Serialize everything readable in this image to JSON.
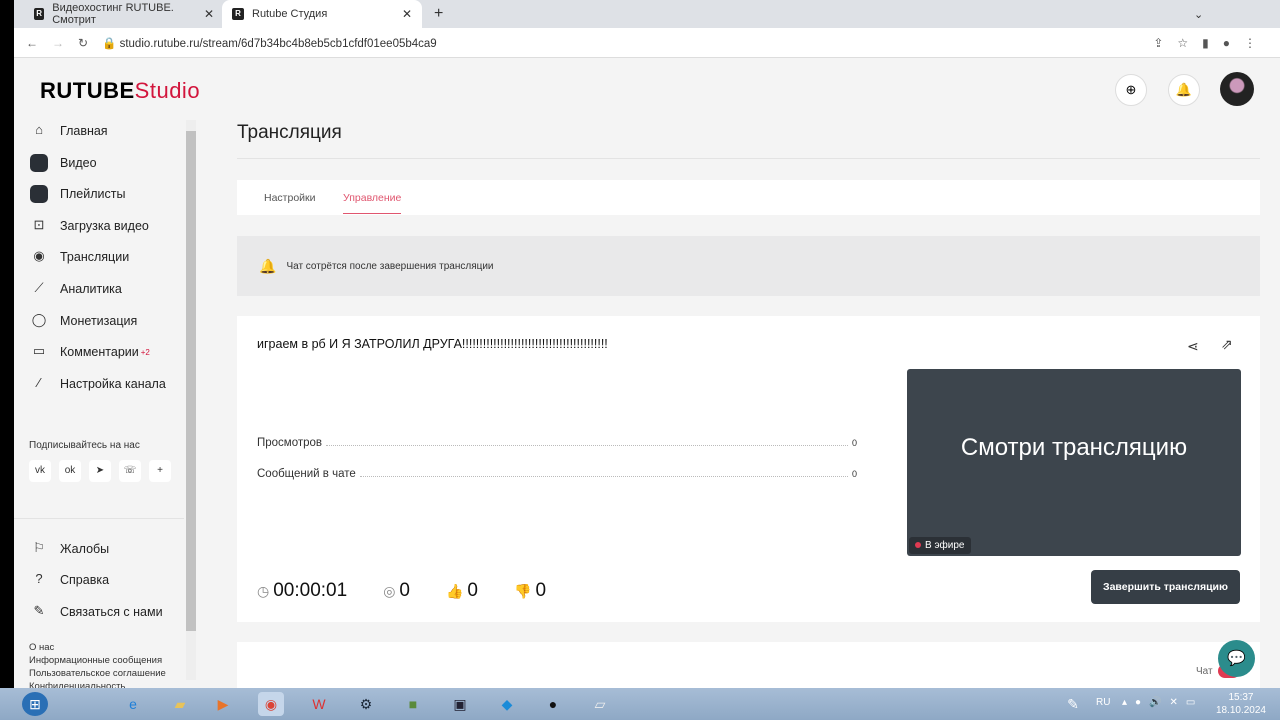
{
  "browser": {
    "tabs": [
      {
        "title": "Видеохостинг RUTUBE. Смотрит"
      },
      {
        "title": "Rutube Студия"
      }
    ],
    "url": "studio.rutube.ru/stream/6d7b34bc4b8eb5cb1cfdf01ee05b4ca9"
  },
  "logo": {
    "main": "RUTUBE",
    "accent": "Studio"
  },
  "sidebar": {
    "items": [
      {
        "label": "Главная"
      },
      {
        "label": "Видео"
      },
      {
        "label": "Плейлисты"
      },
      {
        "label": "Загрузка видео"
      },
      {
        "label": "Трансляции"
      },
      {
        "label": "Аналитика"
      },
      {
        "label": "Монетизация"
      },
      {
        "label": "Комментарии",
        "badge": "+2"
      },
      {
        "label": "Настройка канала"
      }
    ],
    "follow_label": "Подписывайтесь на нас",
    "social": [
      "vk",
      "ok",
      "telegram",
      "viber",
      "plus"
    ],
    "bottom": [
      {
        "label": "Жалобы"
      },
      {
        "label": "Справка"
      },
      {
        "label": "Связаться с нами"
      }
    ],
    "footer": [
      "О нас",
      "Информационные сообщения",
      "Пользовательское соглашение",
      "Конфиденциальность"
    ]
  },
  "main": {
    "title": "Трансляция",
    "tabs": [
      {
        "label": "Настройки"
      },
      {
        "label": "Управление"
      }
    ],
    "alert": "Чат сотрётся после завершения трансляции",
    "stream": {
      "title": "играем в рб И Я ЗАТРОЛИЛ ДРУГА!!!!!!!!!!!!!!!!!!!!!!!!!!!!!!!!!!!!!!!!!!",
      "stats": [
        {
          "label": "Просмотров",
          "value": "0"
        },
        {
          "label": "Сообщений в чате",
          "value": "0"
        }
      ],
      "preview_text": "Смотри трансляцию",
      "live_label": "В эфире",
      "duration": "00:00:01",
      "viewers": "0",
      "likes": "0",
      "dislikes": "0",
      "end_button": "Завершить трансляцию"
    },
    "chat_label": "Чат"
  },
  "taskbar": {
    "lang": "RU",
    "time": "15:37",
    "date": "18.10.2024"
  },
  "colors": {
    "accent": "#d2153c",
    "dark_button": "#363e46",
    "fab": "#2b8c8c"
  }
}
